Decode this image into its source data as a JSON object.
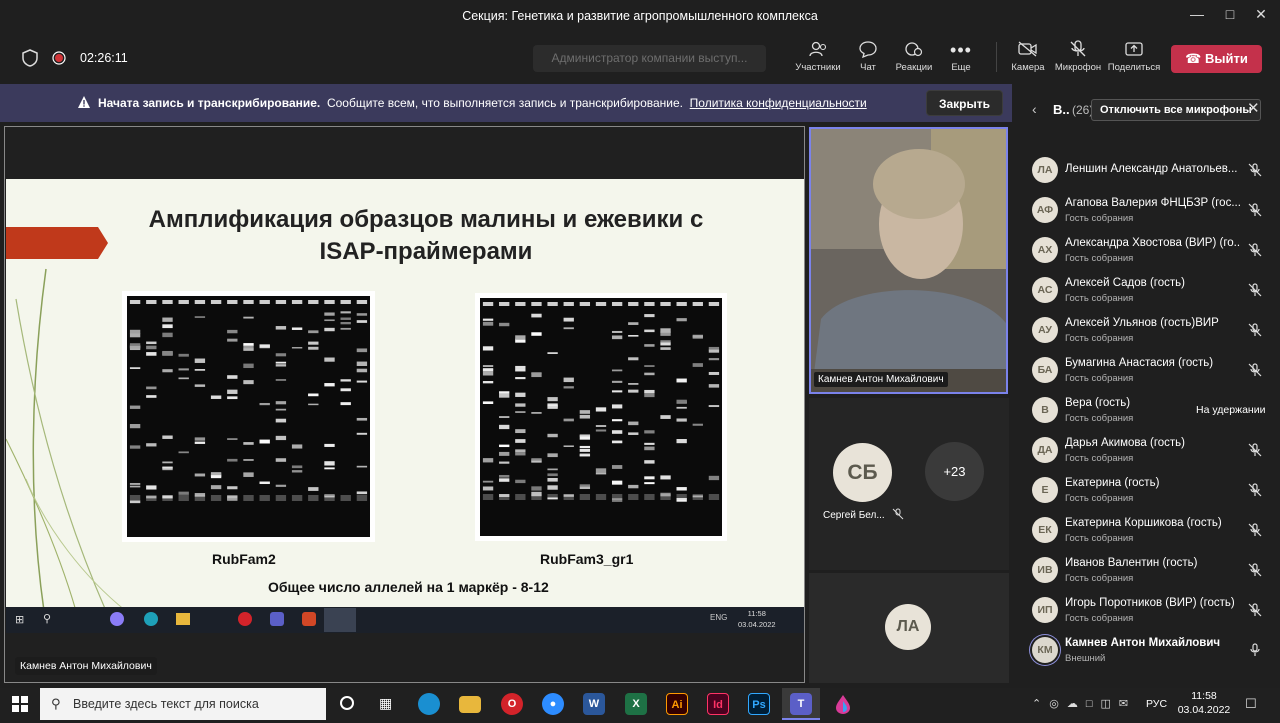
{
  "window": {
    "title": "Секция: Генетика и развитие агропромышленного комплекса"
  },
  "meeting": {
    "timer": "02:26:11",
    "presenter_notice": "Администратор компании выступ...",
    "buttons": {
      "participants": "Участники",
      "chat": "Чат",
      "reactions": "Реакции",
      "more": "Еще",
      "camera": "Камера",
      "mic": "Микрофон",
      "share": "Поделиться",
      "leave": "Выйти"
    }
  },
  "banner": {
    "bold": "Начата запись и транскрибирование.",
    "text": "Сообщите всем, что выполняется запись и транскрибирование.",
    "link": "Политика конфиденциальности",
    "close": "Закрыть"
  },
  "panel": {
    "header_short": "В..",
    "count": "(26)",
    "mute_all": "Отключить все микрофоны",
    "participants": [
      {
        "initials": "ЛА",
        "name": "Леншин Александр Анатольев...",
        "sub": "",
        "status": ""
      },
      {
        "initials": "АФ",
        "name": "Агапова Валерия ФНЦБЗР (гос...",
        "sub": "Гость собрания",
        "status": ""
      },
      {
        "initials": "АХ",
        "name": "Александра Хвостова (ВИР) (го...",
        "sub": "Гость собрания",
        "status": ""
      },
      {
        "initials": "АС",
        "name": "Алексей Садов (гость)",
        "sub": "Гость собрания",
        "status": ""
      },
      {
        "initials": "АУ",
        "name": "Алексей Ульянов (гость)ВИР",
        "sub": "Гость собрания",
        "status": ""
      },
      {
        "initials": "БА",
        "name": "Бумагина Анастасия (гость)",
        "sub": "Гость собрания",
        "status": ""
      },
      {
        "initials": "В",
        "name": "Вера (гость)",
        "sub": "Гость собрания",
        "status": "На удержании"
      },
      {
        "initials": "ДА",
        "name": "Дарья Акимова (гость)",
        "sub": "Гость собрания",
        "status": ""
      },
      {
        "initials": "Е",
        "name": "Екатерина (гость)",
        "sub": "Гость собрания",
        "status": ""
      },
      {
        "initials": "ЕК",
        "name": "Екатерина Коршикова (гость)",
        "sub": "Гость собрания",
        "status": ""
      },
      {
        "initials": "ИВ",
        "name": "Иванов Валентин (гость)",
        "sub": "Гость собрания",
        "status": ""
      },
      {
        "initials": "ИП",
        "name": "Игорь Поротников (ВИР) (гость)",
        "sub": "Гость собрания",
        "status": ""
      },
      {
        "initials": "КМ",
        "name": "Камнев Антон Михайлович",
        "sub": "Внешний",
        "status": ""
      }
    ]
  },
  "share": {
    "presenter_name": "Камнев Антон Михайлович",
    "slide": {
      "title_line1": "Амплификация образцов малины и ежевики с",
      "title_line2": "ISAP-праймерами",
      "gel1_caption": "RubFam2",
      "gel2_caption": "RubFam3_gr1",
      "note": "Общее число аллелей на 1 маркёр - 8-12"
    },
    "remote_taskbar": {
      "lang": "ENG",
      "time": "11:58",
      "date": "03.04.2022"
    }
  },
  "video": {
    "speaker_name": "Камнев Антон Михайлович",
    "tile_sb_initials": "СБ",
    "tile_sb_name": "Сергей Бел...",
    "overflow": "+23",
    "tile_la_initials": "ЛА"
  },
  "os_taskbar": {
    "search_placeholder": "Введите здесь текст для поиска",
    "lang": "РУС",
    "time": "11:58",
    "date": "03.04.2022"
  },
  "colors": {
    "leave_red": "#c4314b",
    "banner_purple": "#3b3a5c",
    "accent": "#7b83eb"
  }
}
